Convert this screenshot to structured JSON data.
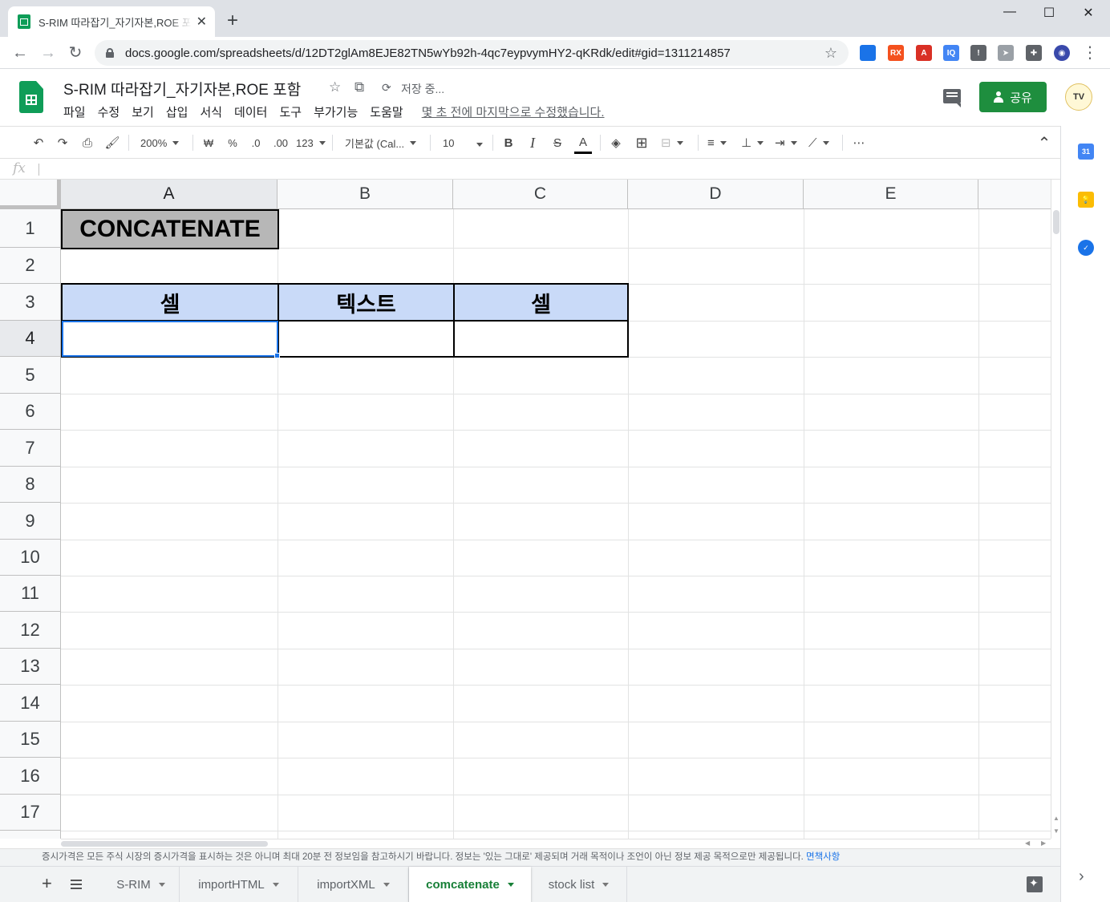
{
  "browser": {
    "tab_title": "S-RIM 따라잡기_자기자본,ROE 포함 - Google 스프레드시트",
    "tab_close": "✕",
    "new_tab": "+",
    "window_controls": [
      "—",
      "☐",
      "✕"
    ],
    "url": "docs.google.com/spreadsheets/d/12DT2glAm8EJE82TN5wYb92h-4qc7eypvymHY2-qKRdk/edit#gid=1311214857",
    "nav": [
      "←",
      "→",
      "↻"
    ],
    "star": "☆",
    "extensions": [
      {
        "name": "cast-extension-icon",
        "label": "",
        "color": "#1a73e8"
      },
      {
        "name": "rx-extension-icon",
        "label": "RX",
        "color": "#f4511e"
      },
      {
        "name": "acrobat-extension-icon",
        "label": "A",
        "color": "#d93025"
      },
      {
        "name": "iq-extension-icon",
        "label": "IQ",
        "color": "#4285f4"
      },
      {
        "name": "info-extension-icon",
        "label": "!",
        "color": "#5f6368"
      },
      {
        "name": "cursor-extension-icon",
        "label": "➤",
        "color": "#9aa0a6"
      },
      {
        "name": "puzzle-extension-icon",
        "label": "✚",
        "color": "#5f6368"
      },
      {
        "name": "profile-extension-icon",
        "label": "◉",
        "color": "#3949ab"
      }
    ],
    "more": "⋮"
  },
  "doc": {
    "title": "S-RIM 따라잡기_자기자본,ROE 포함",
    "save_status": "저장 중...",
    "menus": [
      "파일",
      "수정",
      "보기",
      "삽입",
      "서식",
      "데이터",
      "도구",
      "부가기능",
      "도움말"
    ],
    "last_edit": "몇 초 전에 마지막으로 수정했습니다.",
    "share_label": "공유",
    "avatar_label": "TV"
  },
  "toolbar": {
    "zoom": "200%",
    "currency": "₩",
    "percent": "%",
    "dec_decrease": ".0",
    "dec_increase": ".00",
    "format_more": "123",
    "font": "기본값 (Cal...",
    "font_size": "10",
    "bold": "B",
    "italic": "I",
    "strike": "S",
    "text_color": "A",
    "more": "⋯",
    "collapse": "⌃"
  },
  "formula": {
    "fx": "fx"
  },
  "grid": {
    "columns": [
      "A",
      "B",
      "C",
      "D",
      "E"
    ],
    "rows": [
      "1",
      "2",
      "3",
      "4",
      "5",
      "6",
      "7",
      "8",
      "9",
      "10",
      "11",
      "12",
      "13",
      "14",
      "15",
      "16",
      "17"
    ],
    "cells": {
      "A1": "CONCATENATE",
      "A3": "셀",
      "B3": "텍스트",
      "C3": "셀"
    },
    "selected_cell": "A4"
  },
  "disclaimer": {
    "text": "증시가격은 모든 주식 시장의 증시가격을 표시하는 것은 아니며 최대 20분 전 정보임을 참고하시기 바랍니다. 정보는 '있는 그대로' 제공되며 거래 목적이나 조언이 아닌 정보 제공 목적으로만 제공됩니다. ",
    "link": "면책사항"
  },
  "sheets": {
    "add": "+",
    "tabs": [
      "S-RIM",
      "importHTML",
      "importXML",
      "comcatenate",
      "stock list"
    ],
    "active": "comcatenate"
  },
  "side_panel": {
    "calendar_label": "31",
    "keep_label": "💡",
    "tasks_label": "✓",
    "expand": "›"
  },
  "colors": {
    "accent": "#1a73e8",
    "share_green": "#1e8e3e",
    "header_fill": "#c9daf8",
    "title_fill": "#b7b7b7",
    "active_tab": "#188038"
  }
}
